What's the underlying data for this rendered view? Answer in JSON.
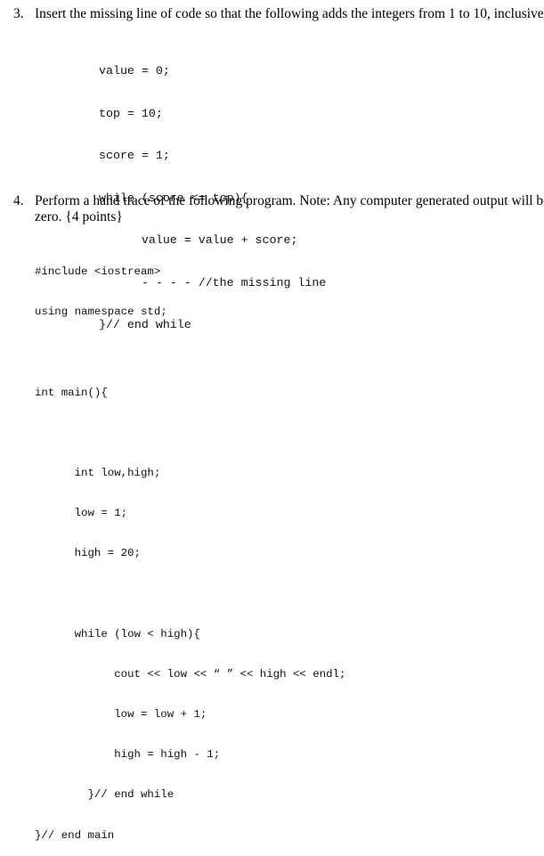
{
  "question3": {
    "number": "3.",
    "prompt": "Insert the missing line of code so that the following adds the integers from 1 to 10, inclusive.",
    "code_lines": [
      "value = 0;",
      "top = 10;",
      "score = 1;",
      "while (score <= top){",
      "      value = value + score;",
      "      - - - - //the missing line",
      "}// end while"
    ]
  },
  "question4": {
    "number": "4.",
    "prompt_line1": "Perform a hand trace of the following program. Note: Any computer generated output will be",
    "prompt_line2": "zero. {4 points}",
    "code_lines": [
      "#include <iostream>",
      "using namespace std;",
      "",
      "int main(){",
      "",
      "      int low,high;",
      "      low = 1;",
      "      high = 20;",
      "",
      "      while (low < high){",
      "            cout << low << “ ” << high << endl;",
      "            low = low + 1;",
      "            high = high - 1;",
      "        }// end while",
      "}// end main"
    ]
  }
}
